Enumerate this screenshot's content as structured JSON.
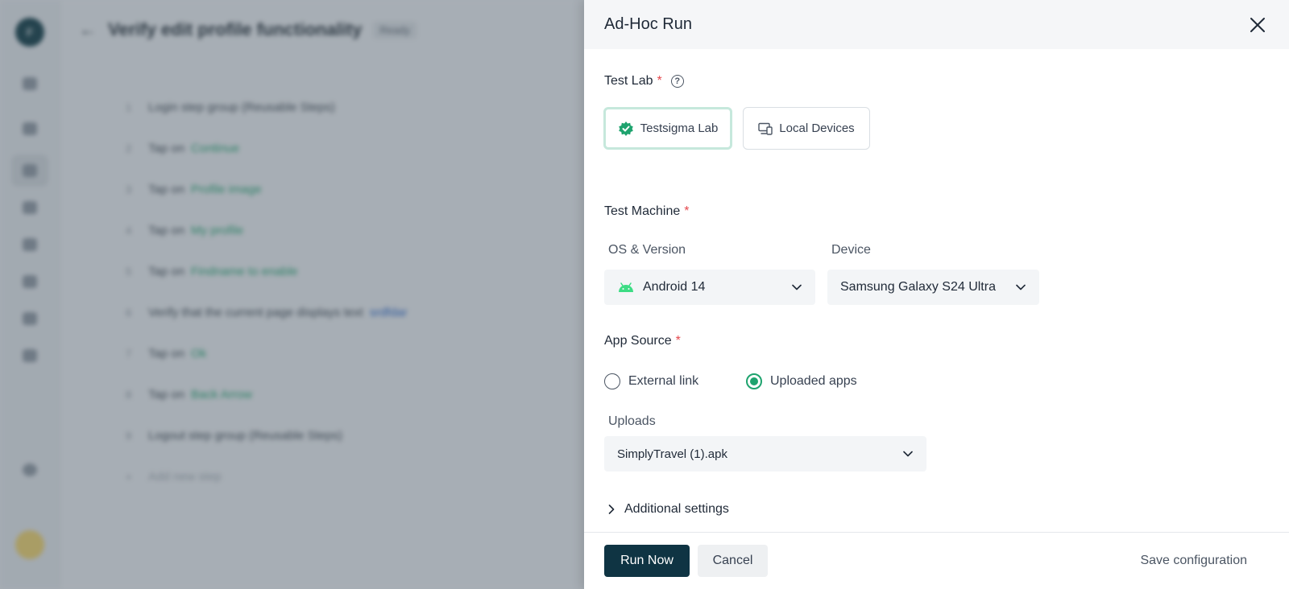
{
  "background": {
    "user_initial": "F",
    "page_title": "Verify edit profile functionality",
    "title_tag": "Ready",
    "steps": [
      {
        "num": "1",
        "text": "Login step group (Reusable Steps)",
        "link": "",
        "link_class": ""
      },
      {
        "num": "2",
        "text": "Tap on",
        "link": "Continue",
        "link_class": "g"
      },
      {
        "num": "3",
        "text": "Tap on",
        "link": "Profile image",
        "link_class": "g"
      },
      {
        "num": "4",
        "text": "Tap on",
        "link": "My profile",
        "link_class": "g"
      },
      {
        "num": "5",
        "text": "Tap on",
        "link": "Findname to enable",
        "link_class": "g"
      },
      {
        "num": "6",
        "text": "Verify that the current page displays text",
        "link": "srdfdar",
        "link_class": "b"
      },
      {
        "num": "7",
        "text": "Tap on",
        "link": "Ok",
        "link_class": "g"
      },
      {
        "num": "8",
        "text": "Tap on",
        "link": "Back Arrow",
        "link_class": "g"
      },
      {
        "num": "9",
        "text": "Logout step group (Reusable Steps)",
        "link": "",
        "link_class": ""
      },
      {
        "num": "+",
        "text": "Add new step",
        "link": "",
        "link_class": "muted"
      }
    ]
  },
  "drawer": {
    "title": "Ad-Hoc Run",
    "test_lab": {
      "label": "Test Lab",
      "required": "*",
      "options": [
        {
          "label": "Testsigma Lab",
          "icon": "gear-badge-icon",
          "selected": true
        },
        {
          "label": "Local Devices",
          "icon": "devices-icon",
          "selected": false
        }
      ]
    },
    "test_machine": {
      "label": "Test Machine",
      "required": "*",
      "os_label": "OS & Version",
      "os_value": "Android 14",
      "device_label": "Device",
      "device_value": "Samsung Galaxy S24 Ultra"
    },
    "app_source": {
      "label": "App Source",
      "required": "*",
      "options": [
        {
          "label": "External link",
          "selected": false
        },
        {
          "label": "Uploaded apps",
          "selected": true
        }
      ],
      "uploads_label": "Uploads",
      "uploads_value": "SimplyTravel (1).apk"
    },
    "additional_settings": "Additional settings",
    "footer": {
      "run_now": "Run Now",
      "cancel": "Cancel",
      "save_config": "Save configuration"
    }
  },
  "colors": {
    "primary": "#0f3443",
    "accent_green": "#1ea36e",
    "required_red": "#e5484d"
  }
}
